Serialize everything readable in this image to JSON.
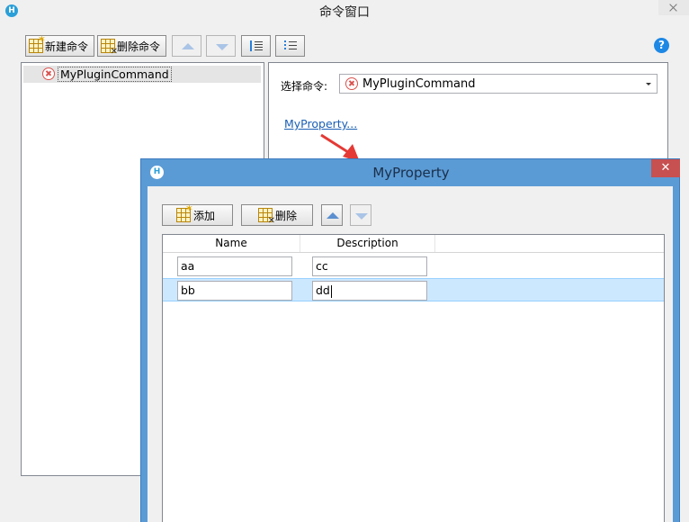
{
  "main_window": {
    "title": "命令窗口",
    "toolbar": {
      "new_command": "新建命令",
      "delete_command": "删除命令"
    },
    "tree": {
      "items": [
        {
          "label": "MyPluginCommand",
          "status_icon": "error-icon"
        }
      ]
    },
    "right": {
      "select_label": "选择命令:",
      "selected_command": "MyPluginCommand",
      "property_link": "MyProperty..."
    },
    "help_glyph": "?"
  },
  "dialog": {
    "title": "MyProperty",
    "close_glyph": "✕",
    "toolbar": {
      "add": "添加",
      "delete": "删除"
    },
    "grid": {
      "columns": [
        "Name",
        "Description"
      ],
      "rows": [
        {
          "name": "aa",
          "description": "cc",
          "selected": false
        },
        {
          "name": "bb",
          "description": "dd",
          "selected": true
        }
      ]
    }
  },
  "colors": {
    "dialog_frame": "#5b9bd5",
    "close_red": "#c75050",
    "link_blue": "#1a5fb4",
    "selection": "#cce8ff",
    "annotation_arrow": "#e53935"
  }
}
